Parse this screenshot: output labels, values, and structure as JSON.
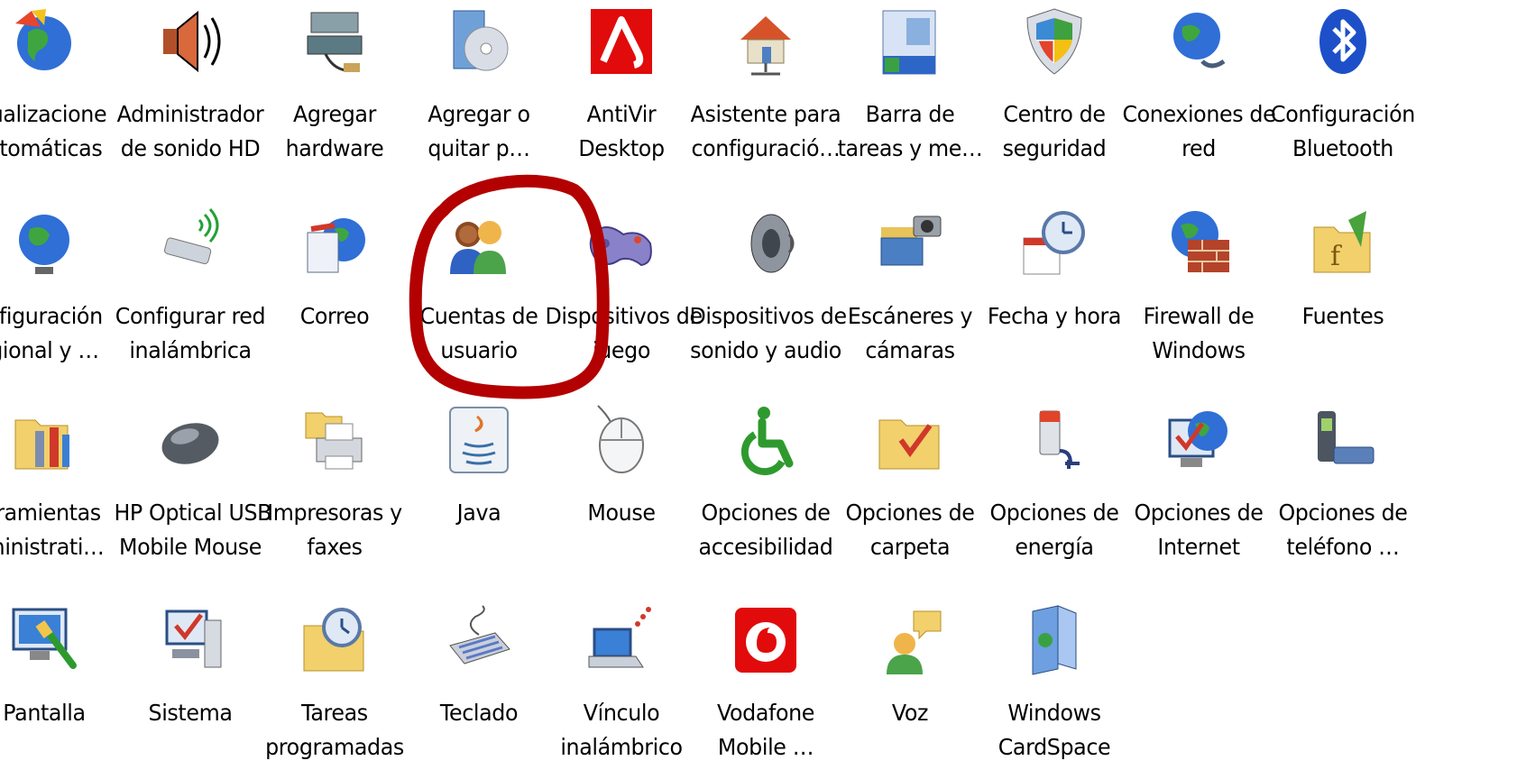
{
  "accent_colors": {
    "highlight_ring": "#b30000"
  },
  "items": [
    {
      "id": "actualizaciones",
      "icon": "globe-shield-icon",
      "line1": "tualizacione",
      "line2": "utomáticas"
    },
    {
      "id": "sonido-hd",
      "icon": "speaker-icon",
      "line1": "Administrador",
      "line2": "de sonido HD"
    },
    {
      "id": "agregar-hardware",
      "icon": "hardware-icon",
      "line1": "Agregar",
      "line2": "hardware"
    },
    {
      "id": "agregar-quitar",
      "icon": "cd-box-icon",
      "line1": "Agregar o",
      "line2": "quitar p…"
    },
    {
      "id": "antivir",
      "icon": "antivir-icon",
      "line1": "AntiVir",
      "line2": "Desktop"
    },
    {
      "id": "asistente",
      "icon": "network-house-icon",
      "line1": "Asistente para",
      "line2": "configuració…"
    },
    {
      "id": "barra-tareas",
      "icon": "taskbar-icon",
      "line1": "Barra de",
      "line2": "tareas y me…"
    },
    {
      "id": "centro-seguridad",
      "icon": "shield-icon",
      "line1": "Centro de",
      "line2": "seguridad"
    },
    {
      "id": "conexiones-red",
      "icon": "network-globe-icon",
      "line1": "Conexiones de",
      "line2": "red"
    },
    {
      "id": "bluetooth",
      "icon": "bluetooth-icon",
      "line1": "Configuración",
      "line2": "Bluetooth"
    },
    {
      "id": "config-regional",
      "icon": "globe-icon",
      "line1": "nfiguración",
      "line2": "gional y …"
    },
    {
      "id": "red-inalambrica",
      "icon": "wireless-adapter-icon",
      "line1": "Configurar red",
      "line2": "inalámbrica"
    },
    {
      "id": "correo",
      "icon": "mail-icon",
      "line1": "Correo",
      "line2": ""
    },
    {
      "id": "cuentas-usuario",
      "icon": "users-icon",
      "line1": "Cuentas de",
      "line2": "usuario"
    },
    {
      "id": "dispositivos-juego",
      "icon": "gamepad-icon",
      "line1": "Dispositivos de",
      "line2": "juego"
    },
    {
      "id": "sonido-audio",
      "icon": "speaker-cone-icon",
      "line1": "Dispositivos de",
      "line2": "sonido y audio"
    },
    {
      "id": "escaneres",
      "icon": "scanner-camera-icon",
      "line1": "Escáneres y",
      "line2": "cámaras"
    },
    {
      "id": "fecha-hora",
      "icon": "calendar-clock-icon",
      "line1": "Fecha y hora",
      "line2": ""
    },
    {
      "id": "firewall",
      "icon": "firewall-icon",
      "line1": "Firewall de",
      "line2": "Windows"
    },
    {
      "id": "fuentes",
      "icon": "fonts-folder-icon",
      "line1": "Fuentes",
      "line2": ""
    },
    {
      "id": "herramientas",
      "icon": "admin-tools-icon",
      "line1": "rramientas",
      "line2": "ministrati…"
    },
    {
      "id": "hp-mouse",
      "icon": "optical-mouse-icon",
      "line1": "HP Optical USB",
      "line2": "Mobile Mouse"
    },
    {
      "id": "impresoras",
      "icon": "printer-icon",
      "line1": "Impresoras y",
      "line2": "faxes"
    },
    {
      "id": "java",
      "icon": "java-icon",
      "line1": "Java",
      "line2": ""
    },
    {
      "id": "mouse",
      "icon": "mouse-icon",
      "line1": "Mouse",
      "line2": ""
    },
    {
      "id": "accesibilidad",
      "icon": "accessibility-icon",
      "line1": "Opciones de",
      "line2": "accesibilidad"
    },
    {
      "id": "carpeta",
      "icon": "folder-check-icon",
      "line1": "Opciones de",
      "line2": "carpeta"
    },
    {
      "id": "energia",
      "icon": "battery-plug-icon",
      "line1": "Opciones de",
      "line2": "energía"
    },
    {
      "id": "internet",
      "icon": "internet-options-icon",
      "line1": "Opciones de",
      "line2": "Internet"
    },
    {
      "id": "telefono",
      "icon": "phone-modem-icon",
      "line1": "Opciones de",
      "line2": "teléfono …"
    },
    {
      "id": "pantalla",
      "icon": "display-icon",
      "line1": "Pantalla",
      "line2": ""
    },
    {
      "id": "sistema",
      "icon": "system-icon",
      "line1": "Sistema",
      "line2": ""
    },
    {
      "id": "tareas-programadas",
      "icon": "scheduled-folder-icon",
      "line1": "Tareas",
      "line2": "programadas"
    },
    {
      "id": "teclado",
      "icon": "keyboard-icon",
      "line1": "Teclado",
      "line2": ""
    },
    {
      "id": "vinculo-inalambrico",
      "icon": "laptop-wireless-icon",
      "line1": "Vínculo",
      "line2": "inalámbrico"
    },
    {
      "id": "vodafone",
      "icon": "vodafone-icon",
      "line1": "Vodafone",
      "line2": "Mobile …"
    },
    {
      "id": "voz",
      "icon": "speech-icon",
      "line1": "Voz",
      "line2": ""
    },
    {
      "id": "cardspace",
      "icon": "cardspace-icon",
      "line1": "Windows",
      "line2": "CardSpace"
    }
  ]
}
